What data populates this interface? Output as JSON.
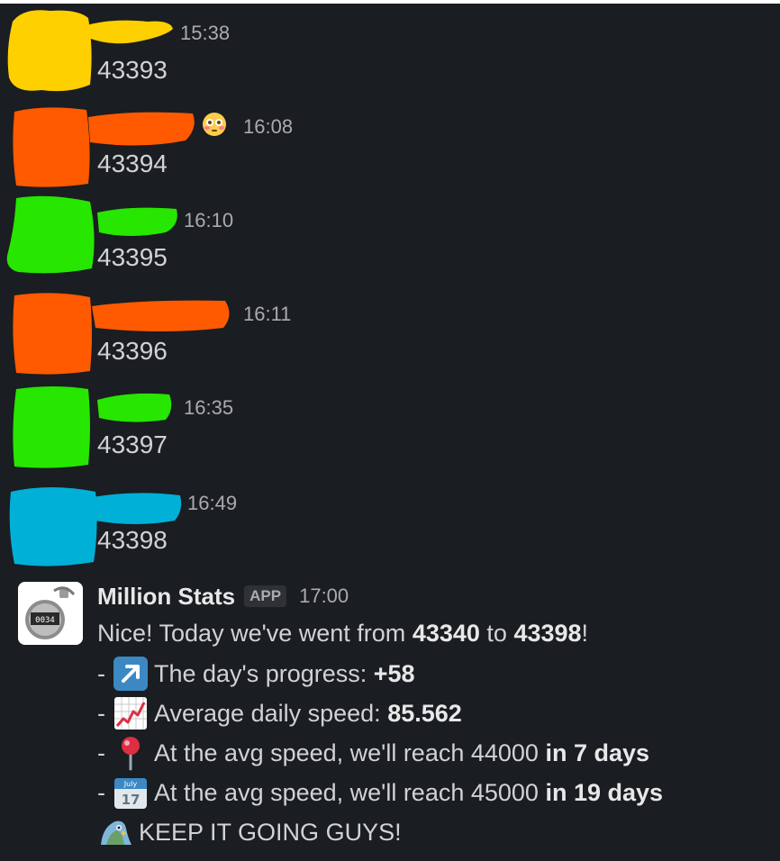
{
  "messages": [
    {
      "time": "15:38",
      "count": "43393",
      "color": "#ffd000"
    },
    {
      "time": "16:08",
      "count": "43394",
      "color": "#ff5a00",
      "status_emoji": "flushed-face-icon"
    },
    {
      "time": "16:10",
      "count": "43395",
      "color": "#27e600"
    },
    {
      "time": "16:11",
      "count": "43396",
      "color": "#ff5a00"
    },
    {
      "time": "16:35",
      "count": "43397",
      "color": "#27e600"
    },
    {
      "time": "16:49",
      "count": "43398",
      "color": "#00b0d6"
    }
  ],
  "bot": {
    "name": "Million Stats",
    "badge": "APP",
    "time": "17:00",
    "intro_pre": "Nice! Today we've went from ",
    "intro_from": "43340",
    "intro_mid": " to ",
    "intro_to": "43398",
    "intro_post": "!",
    "dash": "-",
    "progress_label": "The day's progress: ",
    "progress_value": "+58",
    "speed_label": "Average daily speed: ",
    "speed_value": "85.562",
    "reach1_label": "At the avg speed, we'll reach 44000 ",
    "reach1_value": "in 7 days",
    "reach2_label": "At the avg speed, we'll reach 45000 ",
    "reach2_value": "in 19 days",
    "closing": "KEEP IT GOING GUYS!",
    "calendar_month": "July",
    "calendar_day": "17",
    "counter_digits": "0034",
    "icons": [
      "arrow-up-right-icon",
      "chart-increasing-icon",
      "round-pushpin-icon",
      "calendar-icon",
      "party-parrot-icon"
    ]
  }
}
